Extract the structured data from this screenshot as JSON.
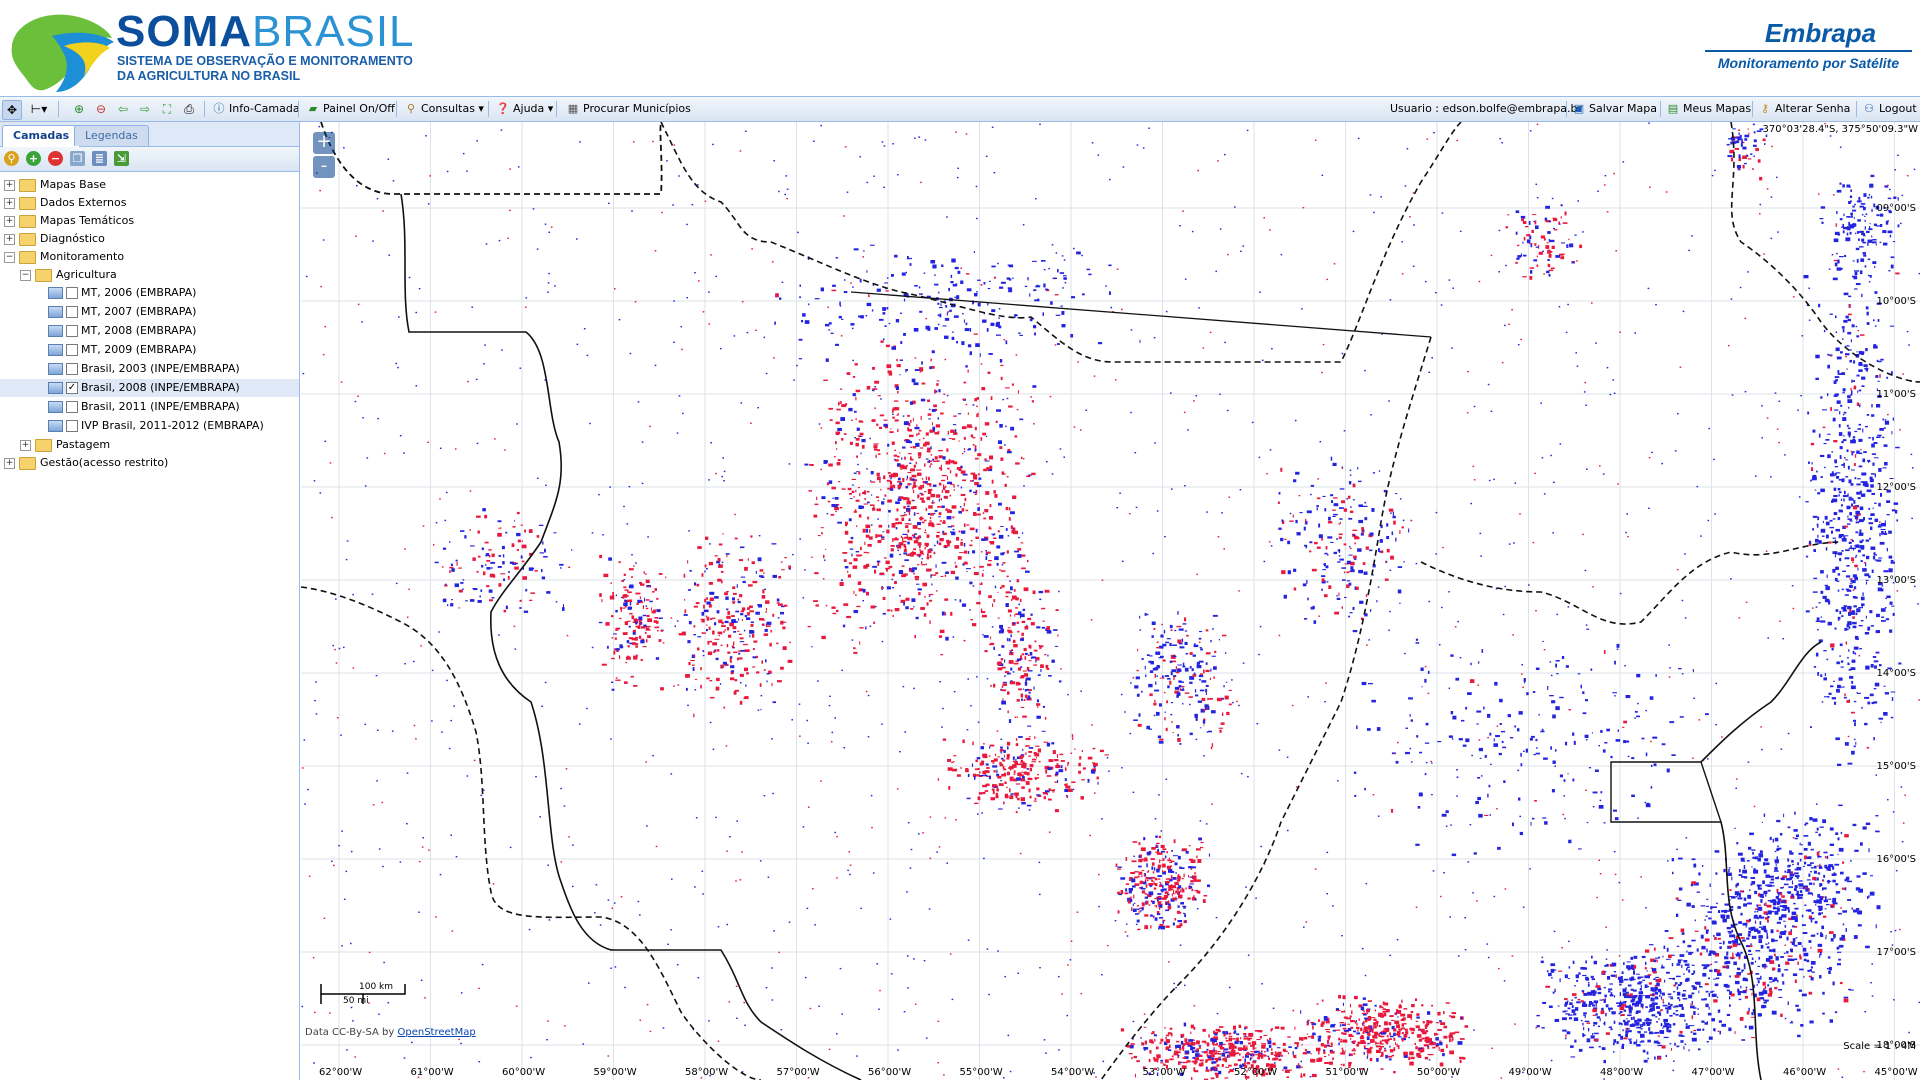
{
  "header": {
    "brand_soma": "SOMA",
    "brand_brasil": "BRASIL",
    "subtitle_line1": "SISTEMA DE OBSERVAÇÃO E MONITORAMENTO",
    "subtitle_line2": "DA AGRICULTURA NO BRASIL",
    "partner_name": "Embrapa",
    "partner_tagline": "Monitoramento por Satélite"
  },
  "toolbar": {
    "info_layer": "Info-Camada",
    "panel_toggle": "Painel On/Off",
    "queries": "Consultas",
    "help": "Ajuda",
    "search_municipalities": "Procurar Municípios",
    "user_label": "Usuario : edson.bolfe@embrapa.br",
    "save_map": "Salvar Mapa",
    "my_maps": "Meus Mapas",
    "change_password": "Alterar Senha",
    "logout": "Logout"
  },
  "sidebar": {
    "tabs": [
      {
        "label": "Camadas",
        "active": true
      },
      {
        "label": "Legendas",
        "active": false
      }
    ],
    "tree": {
      "mapas_base": "Mapas Base",
      "dados_externos": "Dados Externos",
      "mapas_tematicos": "Mapas Temáticos",
      "diagnostico": "Diagnóstico",
      "monitoramento": "Monitoramento",
      "agricultura": "Agricultura",
      "layers": [
        {
          "label": "MT, 2006 (EMBRAPA)",
          "checked": false
        },
        {
          "label": "MT, 2007 (EMBRAPA)",
          "checked": false
        },
        {
          "label": "MT, 2008 (EMBRAPA)",
          "checked": false
        },
        {
          "label": "MT, 2009 (EMBRAPA)",
          "checked": false
        },
        {
          "label": "Brasil, 2003 (INPE/EMBRAPA)",
          "checked": false
        },
        {
          "label": "Brasil, 2008 (INPE/EMBRAPA)",
          "checked": true
        },
        {
          "label": "Brasil, 2011 (INPE/EMBRAPA)",
          "checked": false
        },
        {
          "label": "IVP Brasil, 2011-2012 (EMBRAPA)",
          "checked": false
        }
      ],
      "pastagem": "Pastagem",
      "gestao": "Gestão(acesso restrito)"
    }
  },
  "map": {
    "zoom_in": "+",
    "zoom_out": "-",
    "cursor_coords": "370°03'28.4\"S, 375°50'09.3\"W",
    "lat_labels": [
      "09°00'S",
      "10°00'S",
      "11°00'S",
      "12°00'S",
      "13°00'S",
      "14°00'S",
      "15°00'S",
      "16°00'S",
      "17°00'S",
      "18°00'S"
    ],
    "lon_labels": [
      "62°00'W",
      "61°00'W",
      "60°00'W",
      "59°00'W",
      "58°00'W",
      "57°00'W",
      "56°00'W",
      "55°00'W",
      "54°00'W",
      "53°00'W",
      "52°00'W",
      "51°00'W",
      "50°00'W",
      "49°00'W",
      "48°00'W",
      "47°00'W",
      "46°00'W",
      "45°00'W"
    ],
    "scale_km": "100 km",
    "scale_mi": "50 mi",
    "attribution_prefix": "Data CC-By-SA by",
    "attribution_link": "OpenStreetMap",
    "scale_ratio": "Scale = 1 : 4M",
    "colors": {
      "red_class": "#e8193c",
      "blue_class": "#2323e0",
      "grid": "#dde3ea",
      "boundary": "#111111"
    }
  }
}
